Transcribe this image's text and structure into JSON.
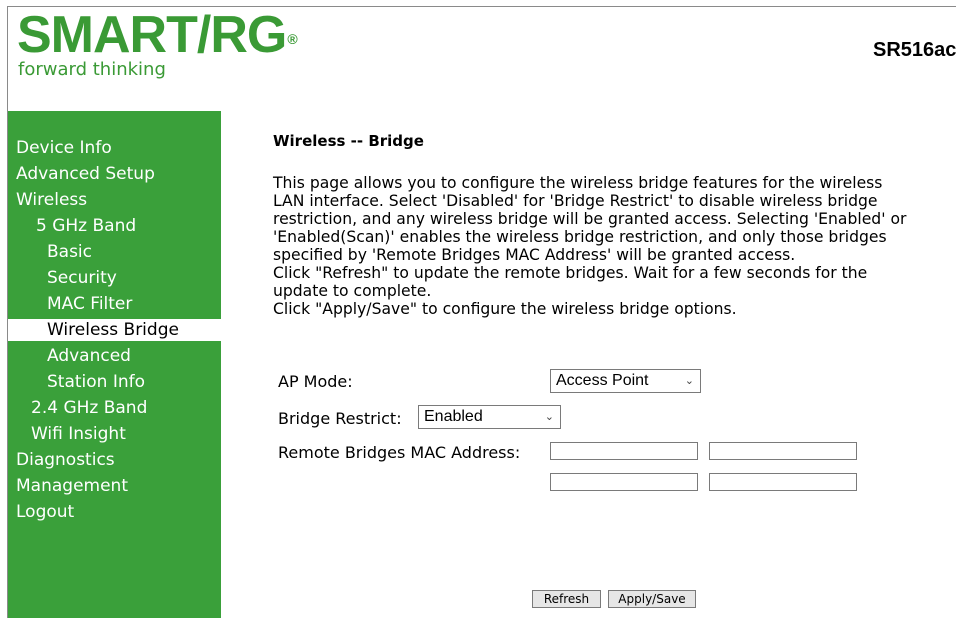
{
  "header": {
    "logo_text": "SMART/RG",
    "logo_registered": "®",
    "tagline": "forward thinking",
    "model": "SR516ac"
  },
  "sidebar": {
    "items": [
      {
        "label": "Device Info"
      },
      {
        "label": "Advanced Setup"
      },
      {
        "label": "Wireless"
      },
      {
        "label": "5 GHz Band"
      },
      {
        "label": "Basic"
      },
      {
        "label": "Security"
      },
      {
        "label": "MAC Filter"
      },
      {
        "label": "Wireless Bridge",
        "active": true
      },
      {
        "label": "Advanced"
      },
      {
        "label": "Station Info"
      },
      {
        "label": "2.4 GHz Band"
      },
      {
        "label": "Wifi Insight"
      },
      {
        "label": "Diagnostics"
      },
      {
        "label": "Management"
      },
      {
        "label": "Logout"
      }
    ]
  },
  "main": {
    "title": "Wireless -- Bridge",
    "description": [
      "This page allows you to configure the wireless bridge features for the wireless",
      "LAN interface. Select 'Disabled' for 'Bridge Restrict' to disable wireless bridge",
      "restriction, and any wireless bridge will be granted access. Selecting 'Enabled' or",
      "'Enabled(Scan)' enables the wireless bridge restriction, and only those bridges",
      "specified by 'Remote Bridges MAC Address' will be granted access.",
      "Click \"Refresh\" to update the remote bridges. Wait for a few seconds for the",
      "update to complete.",
      "Click \"Apply/Save\" to configure the wireless bridge options."
    ],
    "ap_mode": {
      "label": "AP Mode:",
      "value": "Access Point"
    },
    "bridge_restrict": {
      "label": "Bridge Restrict:",
      "value": "Enabled"
    },
    "remote_mac": {
      "label": "Remote Bridges MAC Address:",
      "values": [
        "",
        "",
        "",
        ""
      ]
    },
    "buttons": {
      "refresh": "Refresh",
      "apply_save": "Apply/Save"
    }
  },
  "colors": {
    "brand_green": "#3a9a35",
    "sidebar_green": "#3aa03a"
  }
}
